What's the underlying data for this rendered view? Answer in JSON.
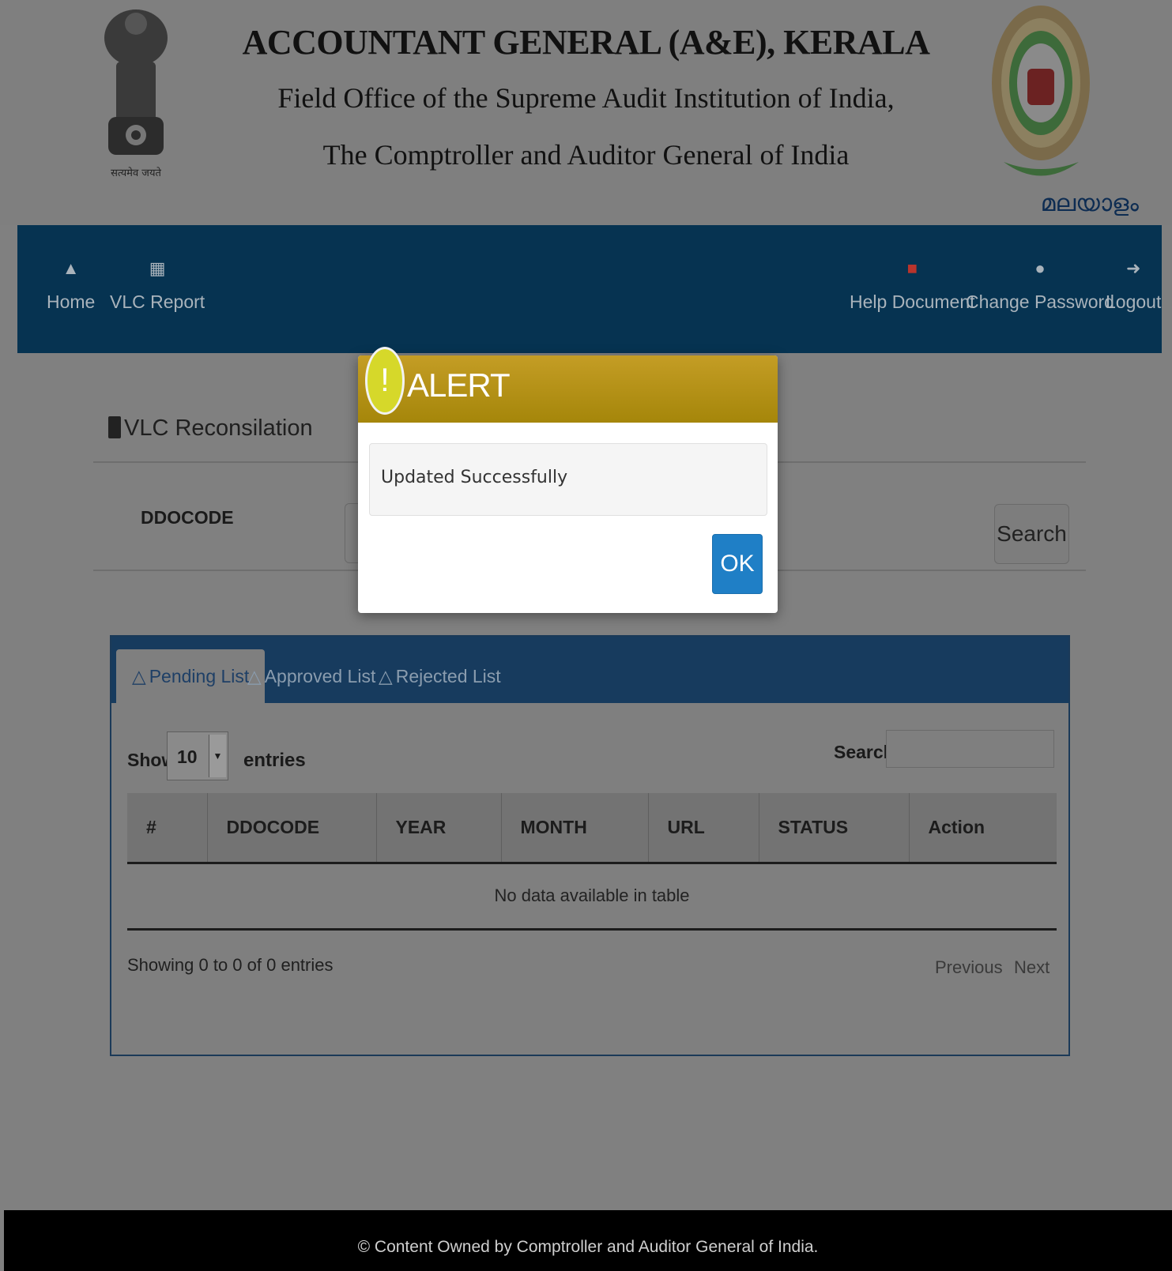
{
  "header": {
    "title_line1": "ACCOUNTANT GENERAL (A&E), KERALA",
    "title_line2": "Field Office of the Supreme Audit Institution of India,",
    "title_line3": "The Comptroller and Auditor General of India",
    "emblem_motto": "सत्यमेव जयते",
    "language_link": "മലയാളം"
  },
  "nav": {
    "left": [
      {
        "label": "Home",
        "icon": "home-icon"
      },
      {
        "label": "VLC Report",
        "icon": "grid-icon"
      }
    ],
    "right": [
      {
        "label": "Help Document",
        "icon": "pdf-icon"
      },
      {
        "label": "Change Password",
        "icon": "user-icon"
      },
      {
        "label": "Logout",
        "icon": "logout-icon"
      }
    ]
  },
  "page": {
    "heading": "VLC Reconsilation",
    "ddo_label": "DDOCODE",
    "search_button": "Search"
  },
  "tabs": [
    {
      "label": "Pending List",
      "active": true
    },
    {
      "label": "Approved List",
      "active": false
    },
    {
      "label": "Rejected List",
      "active": false
    }
  ],
  "table_controls": {
    "show_label": "Show",
    "page_length": "10",
    "entries_label": "entries",
    "search_label": "Search:"
  },
  "table": {
    "columns": [
      "#",
      "DDOCODE",
      "YEAR",
      "MONTH",
      "URL",
      "STATUS",
      "Action"
    ],
    "empty_message": "No data available in table",
    "info": "Showing 0 to 0 of 0 entries",
    "previous": "Previous",
    "next": "Next"
  },
  "modal": {
    "title": "ALERT",
    "icon_glyph": "!",
    "message": "Updated Successfully",
    "ok_label": "OK"
  },
  "footer": {
    "text": "© Content Owned by Comptroller and Auditor General of India."
  },
  "colors": {
    "navbar": "#063351",
    "panel_header": "#173b5e",
    "modal_header": "#b8960f",
    "ok_button": "#1f7fc6",
    "overlay_background": "#808080"
  }
}
